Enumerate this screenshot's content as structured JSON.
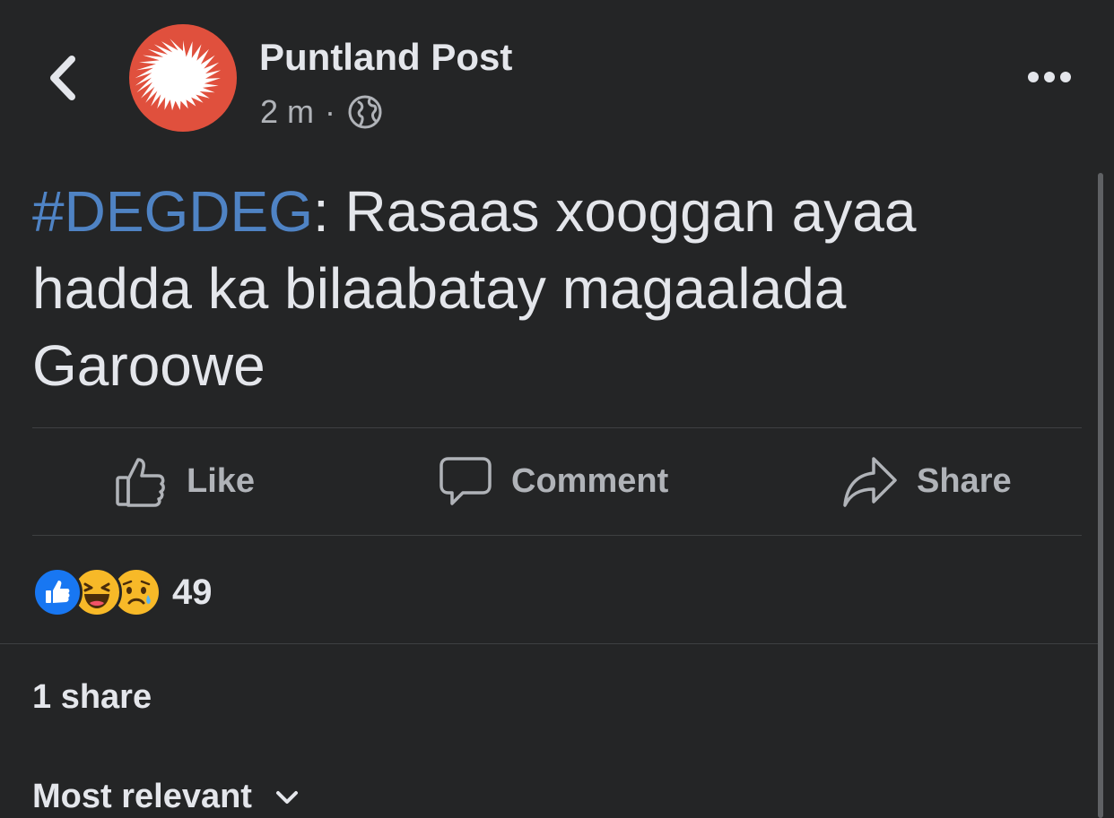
{
  "header": {
    "page_name": "Puntland Post",
    "time": "2 m",
    "separator": "·",
    "privacy_icon": "globe-icon",
    "back_icon": "chevron-left-icon",
    "more_icon": "more-horizontal-icon"
  },
  "post": {
    "hashtag": "#DEGDEG",
    "text": ": Rasaas xooggan ayaa hadda ka bilaabatay magaalada Garoowe"
  },
  "actions": {
    "like_label": "Like",
    "comment_label": "Comment",
    "share_label": "Share"
  },
  "reactions": {
    "icons": [
      "like-reaction-icon",
      "haha-reaction-icon",
      "sad-reaction-icon"
    ],
    "count": "49"
  },
  "shares": {
    "text": "1 share"
  },
  "comments": {
    "sort_label": "Most relevant",
    "sort_icon": "chevron-down-icon"
  },
  "colors": {
    "background": "#242526",
    "hashtag": "#4f83c4",
    "avatar": "#e0503d",
    "secondary_text": "#b0b3b8"
  }
}
